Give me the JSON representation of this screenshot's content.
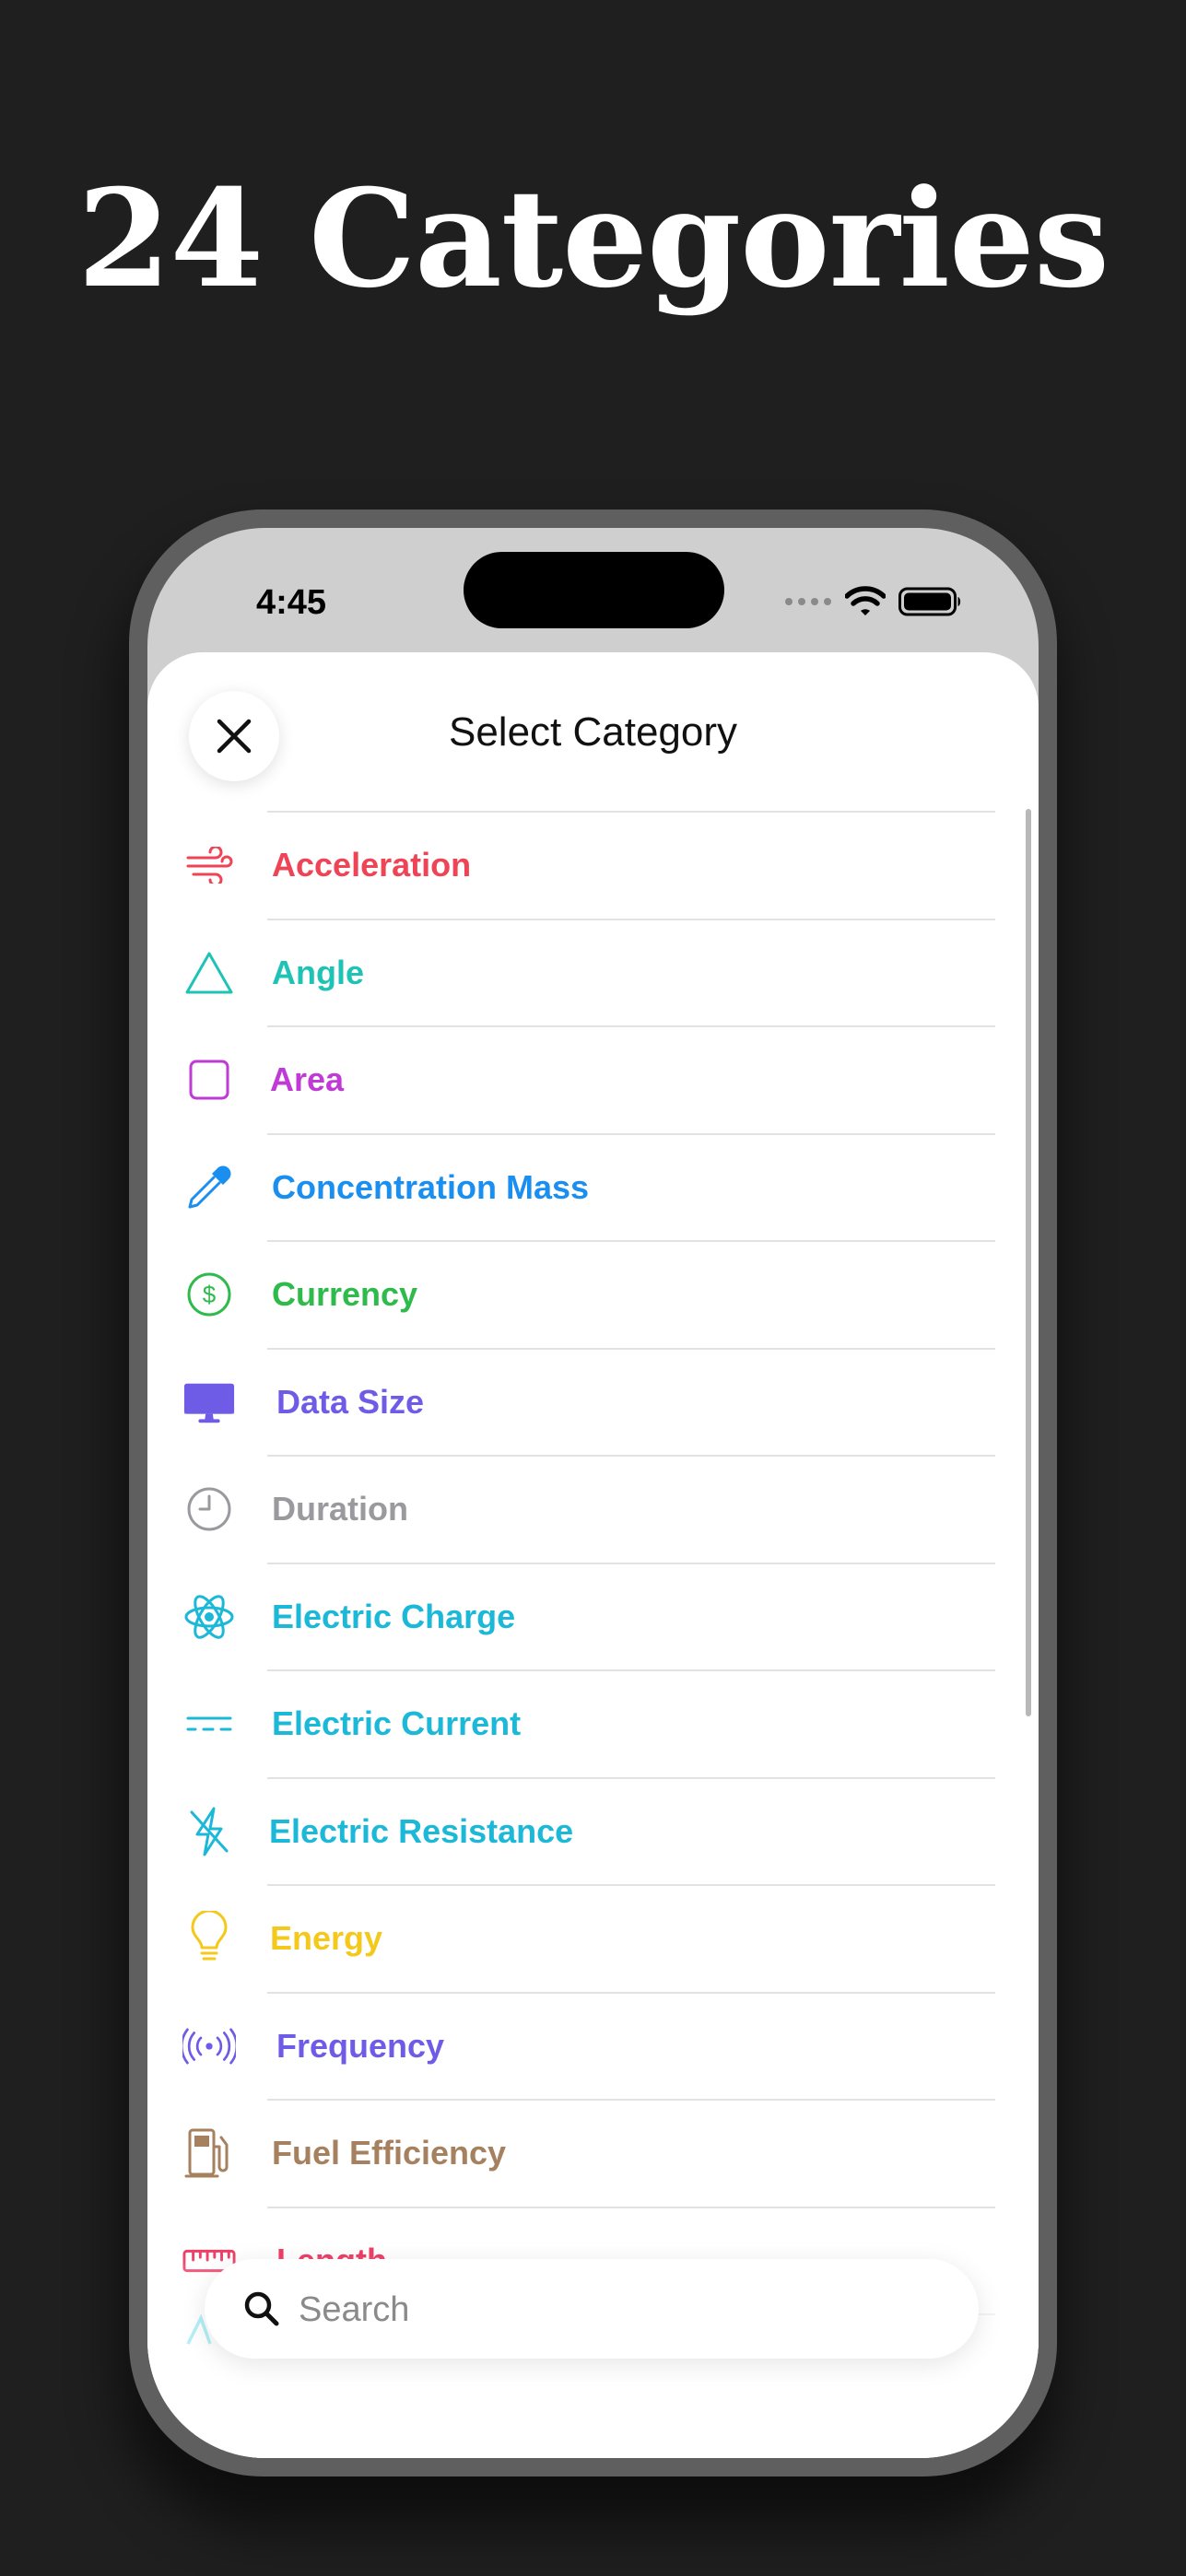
{
  "headline": "24 Categories",
  "status_bar": {
    "time": "4:45"
  },
  "sheet": {
    "title": "Select Category"
  },
  "categories": [
    {
      "label": "Acceleration",
      "icon": "wind-icon",
      "color": "#ef4356"
    },
    {
      "label": "Angle",
      "icon": "triangle-icon",
      "color": "#1fc3b5"
    },
    {
      "label": "Area",
      "icon": "square-icon",
      "color": "#c03ad6"
    },
    {
      "label": "Concentration Mass",
      "icon": "eyedropper-icon",
      "color": "#1b8ff0"
    },
    {
      "label": "Currency",
      "icon": "dollar-circle-icon",
      "color": "#2fba4c"
    },
    {
      "label": "Data Size",
      "icon": "desktop-computer-icon",
      "color": "#6f5ce6"
    },
    {
      "label": "Duration",
      "icon": "clock-icon",
      "color": "#9a9a9e"
    },
    {
      "label": "Electric Charge",
      "icon": "atom-icon",
      "color": "#1cb8d8"
    },
    {
      "label": "Electric Current",
      "icon": "dc-current-icon",
      "color": "#1cb8d8"
    },
    {
      "label": "Electric Resistance",
      "icon": "bolt-slash-icon",
      "color": "#1cb8d8"
    },
    {
      "label": "Energy",
      "icon": "lightbulb-icon",
      "color": "#f4c91c"
    },
    {
      "label": "Frequency",
      "icon": "antenna-waves-icon",
      "color": "#6f5ce6"
    },
    {
      "label": "Fuel Efficiency",
      "icon": "fuel-pump-icon",
      "color": "#a5815f"
    },
    {
      "label": "Length",
      "icon": "ruler-icon",
      "color": "#ee3f67"
    }
  ],
  "search": {
    "placeholder": "Search"
  }
}
